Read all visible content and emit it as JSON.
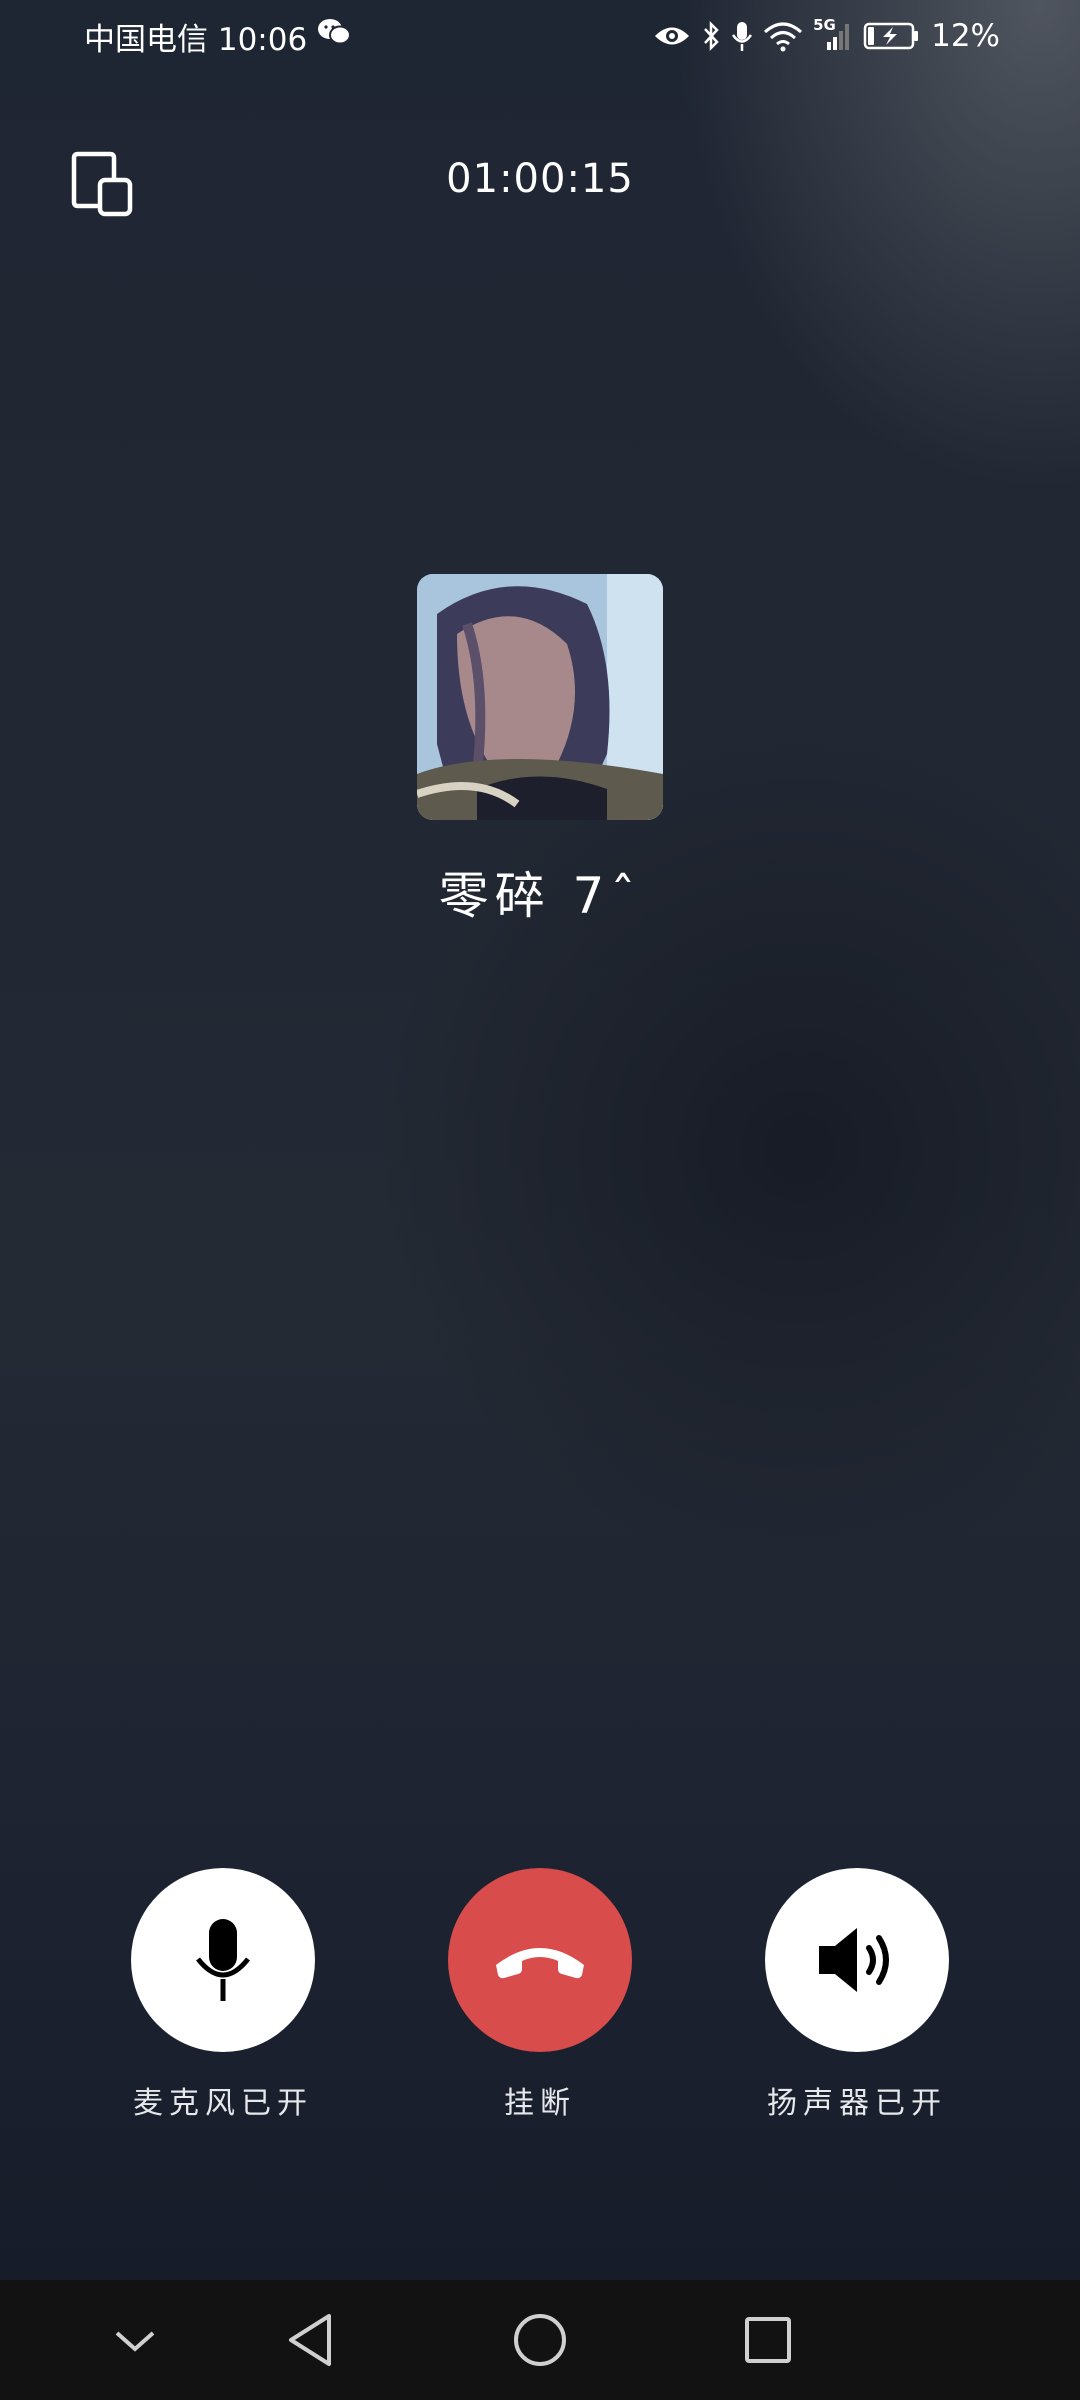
{
  "status_bar": {
    "carrier_time": "中国电信 10:06",
    "battery": "12%",
    "network": "5G",
    "icons": [
      "wechat-icon",
      "eye-icon",
      "bluetooth-icon",
      "mic-icon",
      "wifi-icon",
      "signal-icon",
      "battery-charging-icon"
    ]
  },
  "call": {
    "duration": "01:00:15",
    "caller_name": "零碎 7ˆ"
  },
  "controls": {
    "mic_label": "麦克风已开",
    "hangup_label": "挂断",
    "speaker_label": "扬声器已开"
  },
  "nav": {
    "icons": [
      "chevron-down-icon",
      "back-icon",
      "home-icon",
      "recents-icon"
    ]
  },
  "colors": {
    "hangup": "#d94c4c",
    "button": "#ffffff",
    "nav_bg": "#121212"
  }
}
